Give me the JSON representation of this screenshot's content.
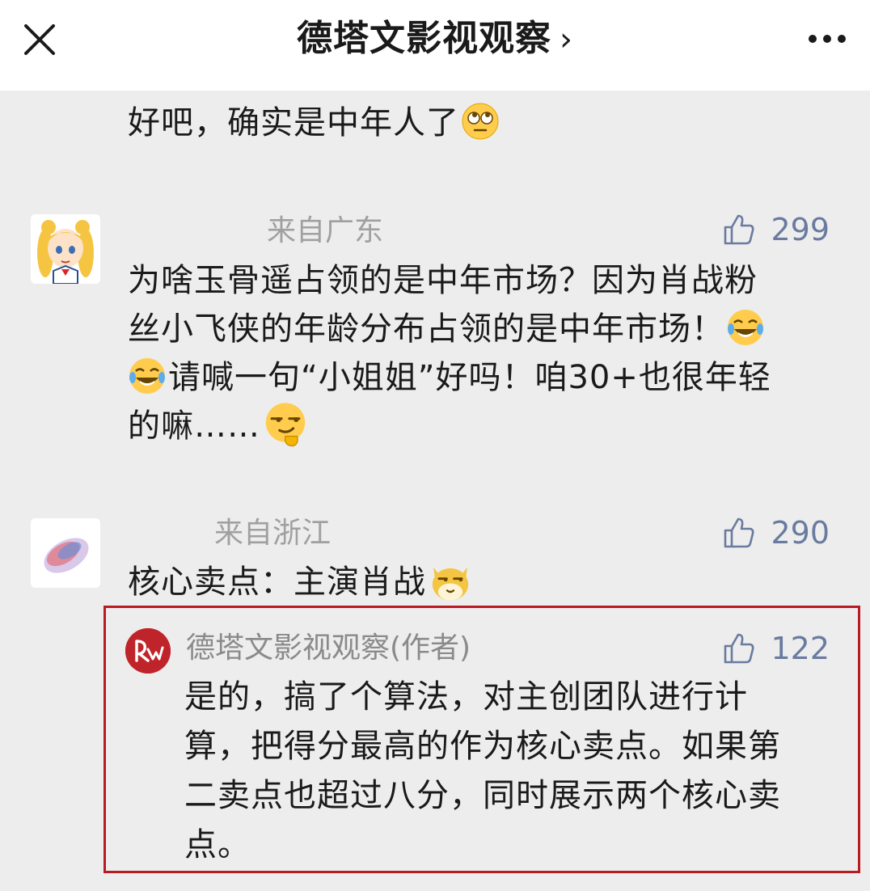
{
  "header": {
    "title": "德塔文影视观察",
    "chevron": "›"
  },
  "comments": [
    {
      "text": "好吧，确实是中年人了"
    },
    {
      "location": "来自广东",
      "likes": "299",
      "lines": [
        "为啥玉骨遥占领的是中年市场？因为肖战粉",
        "丝小飞侠的年龄分布占领的是中年市场！",
        "请喊一句“小姐姐”好吗！咱30+也很年轻",
        "的嘛……"
      ]
    },
    {
      "location": "来自浙江",
      "likes": "290",
      "text": "核心卖点：主演肖战"
    }
  ],
  "reply": {
    "author": "德塔文影视观察(作者)",
    "likes": "122",
    "lines": [
      "是的，搞了个算法，对主创团队进行计",
      "算，把得分最高的作为核心卖点。如果第",
      "二卖点也超过八分，同时展示两个核心卖",
      "点。"
    ]
  },
  "icons": [
    "close-icon",
    "more-icon",
    "thumb-up-icon",
    "rolling-eyes-emoji",
    "laughing-tears-emoji",
    "smirk-emoji",
    "cat-emoji"
  ],
  "colors": {
    "accent_red": "#b81c22",
    "like_blue": "#6a7ba0",
    "background": "#ededed"
  }
}
